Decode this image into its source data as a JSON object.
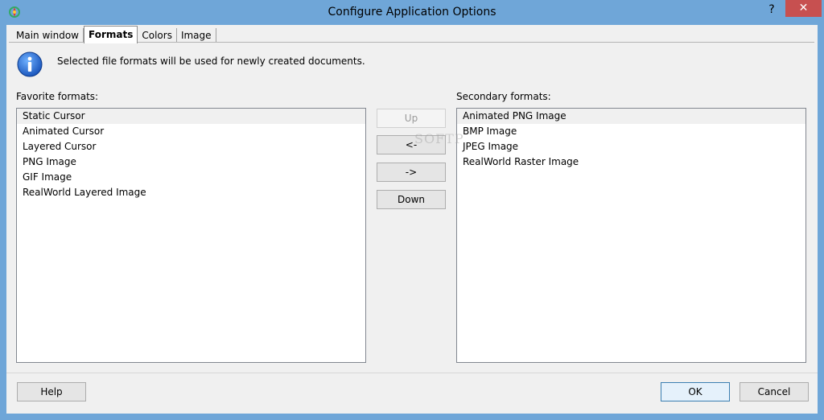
{
  "window": {
    "title": "Configure Application Options",
    "help_glyph": "?",
    "close_glyph": "✕"
  },
  "tabs": [
    {
      "label": "Main window",
      "active": false
    },
    {
      "label": "Formats",
      "active": true
    },
    {
      "label": "Colors",
      "active": false
    },
    {
      "label": "Image",
      "active": false
    }
  ],
  "info": {
    "icon": "info-icon",
    "text": "Selected file formats will be used for newly created documents."
  },
  "favorite": {
    "label": "Favorite formats:",
    "items": [
      "Static Cursor",
      "Animated Cursor",
      "Layered Cursor",
      "PNG Image",
      "GIF Image",
      "RealWorld Layered Image"
    ],
    "selected_index": 0
  },
  "secondary": {
    "label": "Secondary formats:",
    "items": [
      "Animated PNG Image",
      "BMP Image",
      "JPEG Image",
      "RealWorld Raster Image"
    ],
    "selected_index": 0
  },
  "move_buttons": {
    "up": "Up",
    "left": "<-",
    "right": "->",
    "down": "Down"
  },
  "footer": {
    "help": "Help",
    "ok": "OK",
    "cancel": "Cancel"
  },
  "watermark": "SOFTP",
  "colors": {
    "titlebar": "#6fa6d8",
    "close": "#c75050",
    "client": "#f0f0f0"
  }
}
